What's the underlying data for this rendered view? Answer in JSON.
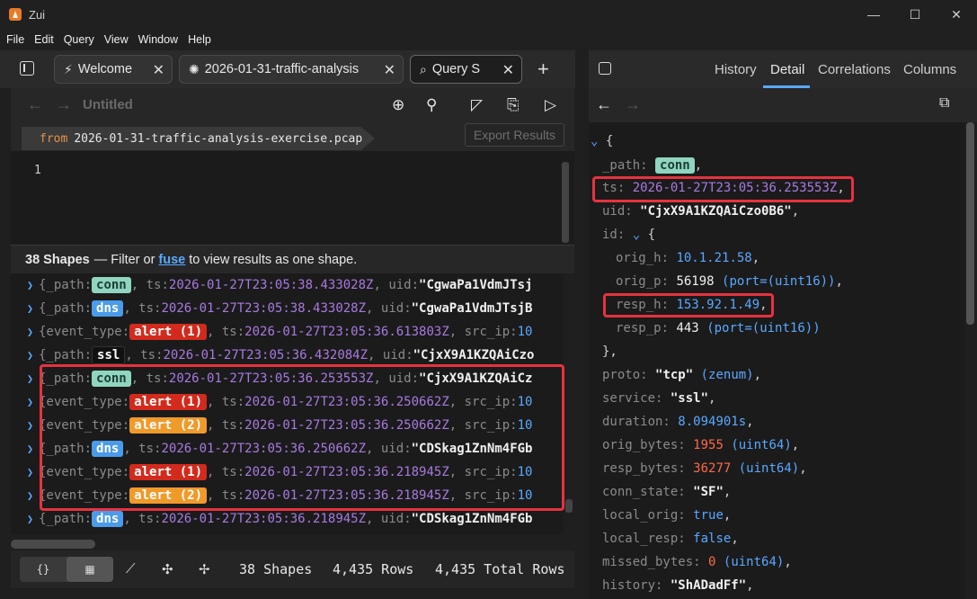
{
  "window": {
    "title": "Zui",
    "minimize": "—",
    "maximize": "☐",
    "close": "✕"
  },
  "menu": [
    "File",
    "Edit",
    "Query",
    "View",
    "Window",
    "Help"
  ],
  "tabs": [
    {
      "label": "Welcome",
      "icon": "zui-logo-icon"
    },
    {
      "label": "2026-01-31-traffic-analysis",
      "icon": "pool-icon"
    },
    {
      "label": "Query S",
      "icon": "search-icon"
    }
  ],
  "editor": {
    "title": "Untitled",
    "from_keyword": "from",
    "from_value": "2026-01-31-traffic-analysis-exercise.pcap",
    "export_label": "Export Results",
    "line_number": "1"
  },
  "results_header": {
    "count": "38 Shapes",
    "text_before": "— Filter or",
    "fuse": "fuse",
    "text_after": "to view results as one shape."
  },
  "results": [
    {
      "key": "{_path:",
      "badge": "conn",
      "badge_type": "conn",
      "ts": "2026-01-27T23:05:38.433028Z",
      "tail_key": ", uid:",
      "tail_val": "\"CgwaPa1VdmJTsj",
      "tail_type": "str"
    },
    {
      "key": "{_path:",
      "badge": "dns",
      "badge_type": "dns",
      "ts": "2026-01-27T23:05:38.433028Z",
      "tail_key": ", uid:",
      "tail_val": "\"CgwaPa1VdmJTsjB",
      "tail_type": "str"
    },
    {
      "key": "{event_type:",
      "badge": "alert (1)",
      "badge_type": "alert1",
      "ts": "2026-01-27T23:05:36.613803Z",
      "tail_key": ", src_ip:",
      "tail_val": "10",
      "tail_type": "num"
    },
    {
      "key": "{_path:",
      "badge": "ssl",
      "badge_type": "ssl",
      "ts": "2026-01-27T23:05:36.432084Z",
      "tail_key": ", uid:",
      "tail_val": "\"CjxX9A1KZQAiCzo",
      "tail_type": "str"
    },
    {
      "key": "{_path:",
      "badge": "conn",
      "badge_type": "conn",
      "ts": "2026-01-27T23:05:36.253553Z",
      "tail_key": ", uid:",
      "tail_val": "\"CjxX9A1KZQAiCz",
      "tail_type": "str"
    },
    {
      "key": "{event_type:",
      "badge": "alert (1)",
      "badge_type": "alert1",
      "ts": "2026-01-27T23:05:36.250662Z",
      "tail_key": ", src_ip:",
      "tail_val": "10",
      "tail_type": "num"
    },
    {
      "key": "{event_type:",
      "badge": "alert (2)",
      "badge_type": "alert2",
      "ts": "2026-01-27T23:05:36.250662Z",
      "tail_key": ", src_ip:",
      "tail_val": "10",
      "tail_type": "num"
    },
    {
      "key": "{_path:",
      "badge": "dns",
      "badge_type": "dns",
      "ts": "2026-01-27T23:05:36.250662Z",
      "tail_key": ", uid:",
      "tail_val": "\"CDSkag1ZnNm4FGb",
      "tail_type": "str"
    },
    {
      "key": "{event_type:",
      "badge": "alert (1)",
      "badge_type": "alert1",
      "ts": "2026-01-27T23:05:36.218945Z",
      "tail_key": ", src_ip:",
      "tail_val": "10",
      "tail_type": "num"
    },
    {
      "key": "{event_type:",
      "badge": "alert (2)",
      "badge_type": "alert2",
      "ts": "2026-01-27T23:05:36.218945Z",
      "tail_key": ", src_ip:",
      "tail_val": "10",
      "tail_type": "num"
    },
    {
      "key": "{_path:",
      "badge": "dns",
      "badge_type": "dns",
      "ts": "2026-01-27T23:05:36.218945Z",
      "tail_key": ", uid:",
      "tail_val": "\"CDSkag1ZnNm4FGb",
      "tail_type": "str"
    }
  ],
  "statusbar": {
    "shapes": "38 Shapes",
    "rows": "4,435 Rows",
    "total_rows": "4,435 Total Rows"
  },
  "right_panel": {
    "tabs": [
      "History",
      "Detail",
      "Correlations",
      "Columns"
    ],
    "active_tab": "Detail"
  },
  "detail": {
    "open": "{",
    "path_key": "_path:",
    "path_val": "conn",
    "ts_key": "ts:",
    "ts_val": "2026-01-27T23:05:36.253553Z",
    "uid_key": "uid:",
    "uid_val": "\"CjxX9A1KZQAiCzo0B6\"",
    "id_key": "id:",
    "id_open": "{",
    "orig_h_key": "orig_h:",
    "orig_h_val": "10.1.21.58",
    "orig_p_key": "orig_p:",
    "orig_p_val": "56198",
    "orig_p_type": "(port=(uint16))",
    "resp_h_key": "resp_h:",
    "resp_h_val": "153.92.1.49",
    "resp_p_key": "resp_p:",
    "resp_p_val": "443",
    "resp_p_type": "(port=(uint16))",
    "id_close": "},",
    "proto_key": "proto:",
    "proto_val": "\"tcp\"",
    "proto_type": "(zenum)",
    "service_key": "service:",
    "service_val": "\"ssl\"",
    "duration_key": "duration:",
    "duration_val": "8.094901s",
    "orig_bytes_key": "orig_bytes:",
    "orig_bytes_val": "1955",
    "orig_bytes_type": "(uint64)",
    "resp_bytes_key": "resp_bytes:",
    "resp_bytes_val": "36277",
    "resp_bytes_type": "(uint64)",
    "conn_state_key": "conn_state:",
    "conn_state_val": "\"SF\"",
    "local_orig_key": "local_orig:",
    "local_orig_val": "true",
    "local_resp_key": "local_resp:",
    "local_resp_val": "false",
    "missed_bytes_key": "missed_bytes:",
    "missed_bytes_val": "0",
    "missed_bytes_type": "(uint64)",
    "history_key": "history:",
    "history_val": "\"ShADadFf\""
  }
}
